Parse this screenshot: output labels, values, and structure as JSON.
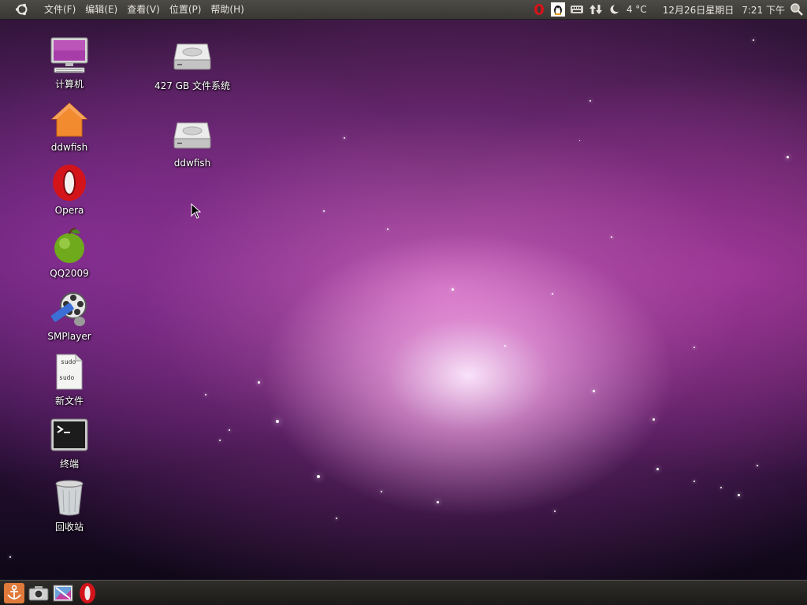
{
  "top_panel": {
    "menus": [
      "文件(F)",
      "编辑(E)",
      "查看(V)",
      "位置(P)",
      "帮助(H)"
    ],
    "tray": {
      "icons": [
        "opera-tray-icon",
        "qq-tray-icon",
        "keyboard-icon",
        "network-arrows-icon",
        "moon-icon"
      ],
      "weather": "4 °C",
      "date": "12月26日星期日",
      "time": "7:21 下午"
    }
  },
  "desktop": {
    "icons": [
      {
        "name": "computer-icon",
        "label": "计算机"
      },
      {
        "name": "home-folder-icon",
        "label": "ddwfish"
      },
      {
        "name": "opera-icon",
        "label": "Opera"
      },
      {
        "name": "qq-icon",
        "label": "QQ2009"
      },
      {
        "name": "smplayer-icon",
        "label": "SMPlayer"
      },
      {
        "name": "text-file-icon",
        "label": "新文件",
        "preview_lines": [
          "sudo",
          "sudo"
        ]
      },
      {
        "name": "terminal-icon",
        "label": "终端"
      },
      {
        "name": "trash-icon",
        "label": "回收站"
      },
      {
        "name": "hard-drive-icon",
        "label": "427 GB 文件系统"
      },
      {
        "name": "hard-drive-icon",
        "label": "ddwfish"
      }
    ]
  },
  "bottom_panel": {
    "launchers": [
      "anchor-icon",
      "camera-icon",
      "image-editor-icon",
      "opera-icon"
    ]
  }
}
